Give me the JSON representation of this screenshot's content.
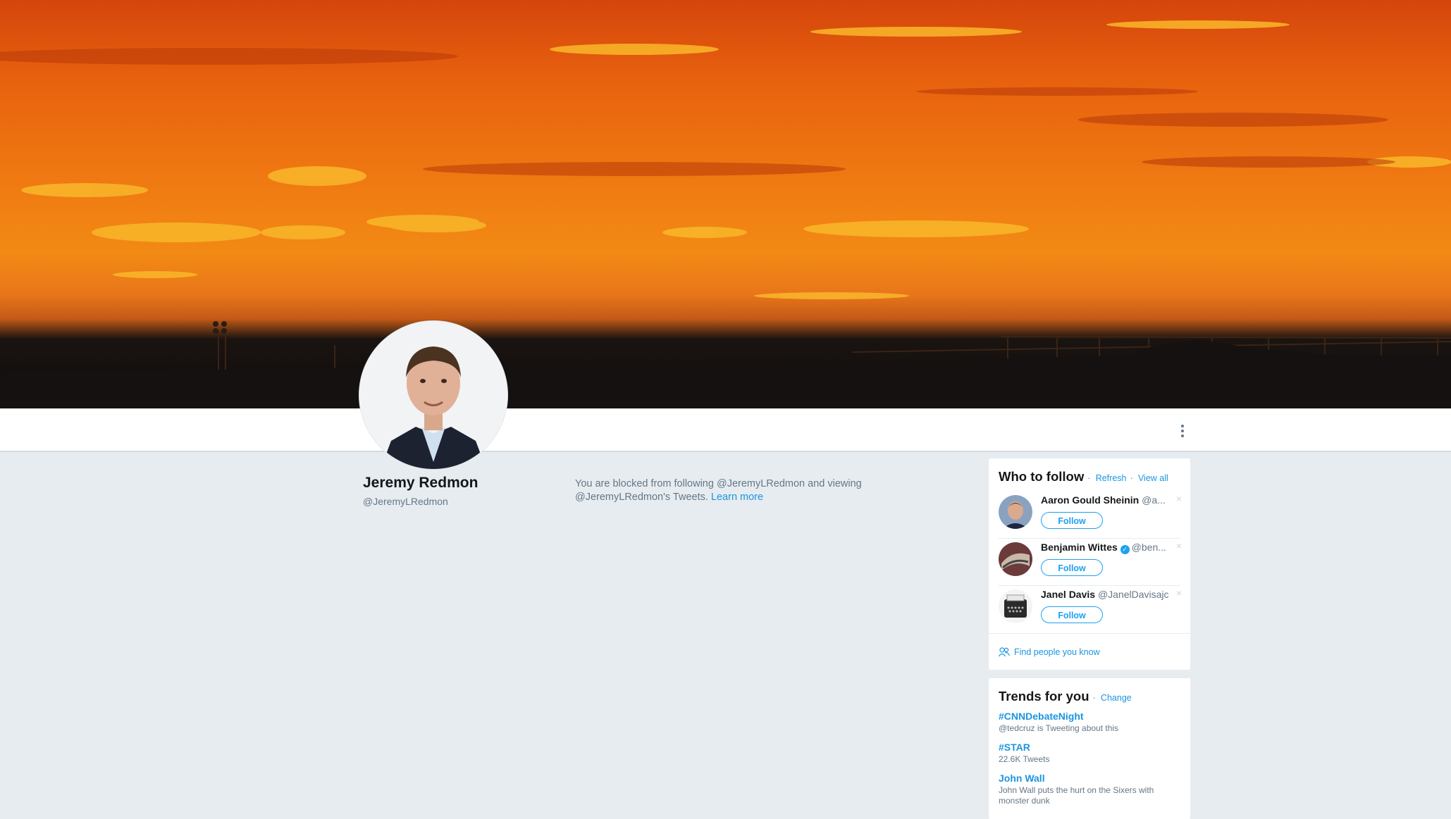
{
  "profile": {
    "name": "Jeremy Redmon",
    "handle": "@JeremyLRedmon"
  },
  "blocked_message": {
    "text": "You are blocked from following @JeremyLRedmon and viewing @JeremyLRedmon's Tweets.",
    "link": "Learn more"
  },
  "who_to_follow": {
    "title": "Who to follow",
    "refresh": "Refresh",
    "separator": "·",
    "view_all": "View all",
    "follow_label": "Follow",
    "dismiss": "×",
    "users": [
      {
        "name": "Aaron Gould Sheinin",
        "handle": "@a...",
        "verified": false
      },
      {
        "name": "Benjamin Wittes",
        "handle": "@ben...",
        "verified": true
      },
      {
        "name": "Janel Davis",
        "handle": "@JanelDavisajc",
        "verified": false
      }
    ],
    "find_people": "Find people you know"
  },
  "trends": {
    "title": "Trends for you",
    "change": "Change",
    "items": [
      {
        "name": "#CNNDebateNight",
        "desc": "@tedcruz is Tweeting about this"
      },
      {
        "name": "#STAR",
        "desc": "22.6K Tweets"
      },
      {
        "name": "John Wall",
        "desc": "John Wall puts the hurt on the Sixers with monster dunk"
      }
    ]
  },
  "colors": {
    "link": "#1b95e0",
    "background": "#e6ecf0",
    "banner_sky": "#f07a12"
  }
}
